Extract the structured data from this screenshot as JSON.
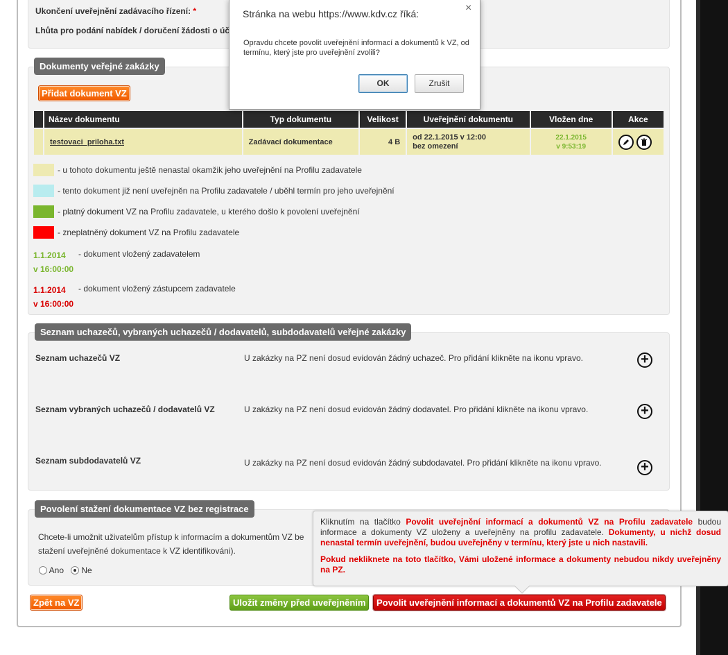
{
  "top_fields": {
    "end_label": "Ukončení uveřejnění zadávacího řízení:",
    "required_mark": "*",
    "deadline_label": "Lhůta pro podání nabídek / doručení žádosti o úča"
  },
  "documents_panel": {
    "title": "Dokumenty veřejné zakázky",
    "add_button": "Přidat dokument VZ",
    "columns": [
      "Název dokumentu",
      "Typ dokumentu",
      "Velikost",
      "Uveřejnění dokumentu",
      "Vložen dne",
      "Akce"
    ],
    "rows": [
      {
        "name": "testovaci_priloha.txt",
        "type": "Zadávací dokumentace",
        "size": "4 B",
        "publish_from": "od 22.1.2015 v 12:00",
        "publish_limit": "bez omezení",
        "inserted_date": "22.1.2015",
        "inserted_time": "v 9:53:19"
      }
    ],
    "legend": [
      {
        "color": "#eeeab2",
        "text": "- u tohoto dokumentu ještě nenastal okamžik jeho uveřejnění na Profilu zadavatele"
      },
      {
        "color": "#b8ecef",
        "text": "- tento dokument již není uveřejněn na Profilu zadavatele / uběhl termín pro jeho uveřejnění"
      },
      {
        "color": "#7ab62e",
        "text": "- platný dokument VZ na Profilu zadavatele, u kterého došlo k povolení uveřejnění"
      },
      {
        "color": "#ff0000",
        "text": "- zneplatněný dokument VZ na Profilu zadavatele"
      }
    ],
    "date_legend": [
      {
        "date": "1.1.2014",
        "time": "v 16:00:00",
        "text": "- dokument vložený zadavatelem"
      },
      {
        "date": "1.1.2014",
        "time": "v 16:00:00",
        "text": "- dokument vložený zástupcem zadavatele"
      }
    ]
  },
  "bidders_panel": {
    "title": "Seznam uchazečů, vybraných uchazečů / dodavatelů, subdodavatelů veřejné zakázky",
    "rows": [
      {
        "label": "Seznam uchazečů VZ",
        "text": "U zakázky na PZ není dosud evidován žádný uchazeč. Pro přidání klikněte na ikonu vpravo."
      },
      {
        "label": "Seznam vybraných uchazečů / dodavatelů VZ",
        "text": "U zakázky na PZ není dosud evidován žádný dodavatel. Pro přidání klikněte na ikonu vpravo."
      },
      {
        "label": "Seznam subdodavatelů VZ",
        "text": "U zakázky na PZ není dosud evidován žádný subdodavatel. Pro přidání klikněte na ikonu vpravo."
      }
    ]
  },
  "download_panel": {
    "title": "Povolení stažení dokumentace VZ bez registrace",
    "text_line1": "Chcete-li umožnit uživatelům přístup k informacím a dokumentům VZ be",
    "text_line2": "stažení uveřejněné dokumentace k VZ identifikováni).",
    "radio_yes": "Ano",
    "radio_no": "Ne"
  },
  "footer_buttons": {
    "back": "Zpět na VZ",
    "save": "Uložit změny před uveřejněním",
    "publish": "Povolit uveřejnění informací a dokumentů VZ na Profilu zadavatele"
  },
  "tooltip": {
    "p1_a": "Kliknutím na tlačítko ",
    "p1_hl1": "Povolit uveřejnění informací a dokumentů VZ na Profilu zadavatele",
    "p1_b": " budou informace a dokumenty VZ uloženy a uveřejněny na profilu zadavatele. ",
    "p1_hl2": "Dokumenty, u nichž dosud nenastal termín uveřejnění, budou uveřejněny v termínu, který jste u nich nastavili.",
    "p2": "Pokud nekliknete na toto tlačítko, Vámi uložené informace a dokumenty nebudou nikdy uveřejněny na PZ."
  },
  "dialog": {
    "title": "Stránka na webu https://www.kdv.cz říká:",
    "close": "×",
    "message": "Opravdu chcete povolit uveřejnění informací a dokumentů k VZ, od termínu, který jste pro uveřejnění zvolili?",
    "ok": "OK",
    "cancel": "Zrušit"
  }
}
